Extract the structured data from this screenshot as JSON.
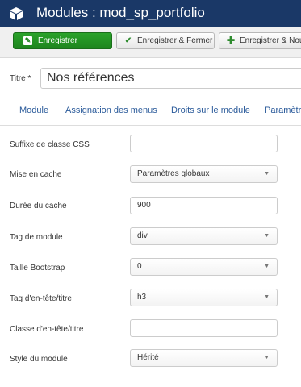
{
  "header": {
    "title": "Modules : mod_sp_portfolio",
    "icon": "cube-icon",
    "bg_color": "#1a3867"
  },
  "toolbar": {
    "save_label": "Enregistrer",
    "save_close_label": "Enregistrer & Fermer",
    "save_new_label": "Enregistrer & Nouv",
    "save_color": "#1e851e"
  },
  "title_field": {
    "label": "Titre *",
    "value": "Nos références"
  },
  "tabs": [
    {
      "label": "Module"
    },
    {
      "label": "Assignation des menus"
    },
    {
      "label": "Droits sur le module"
    },
    {
      "label": "Paramètre"
    }
  ],
  "fields": {
    "css_suffix": {
      "label": "Suffixe de classe CSS",
      "value": ""
    },
    "cache": {
      "label": "Mise en cache",
      "value": "Paramètres globaux"
    },
    "cache_time": {
      "label": "Durée du cache",
      "value": "900"
    },
    "module_tag": {
      "label": "Tag de module",
      "value": "div"
    },
    "bootstrap_size": {
      "label": "Taille Bootstrap",
      "value": "0"
    },
    "header_tag": {
      "label": "Tag d'en-tête/titre",
      "value": "h3"
    },
    "header_class": {
      "label": "Classe d'en-tête/titre",
      "value": ""
    },
    "module_style": {
      "label": "Style du module",
      "value": "Hérité"
    }
  }
}
